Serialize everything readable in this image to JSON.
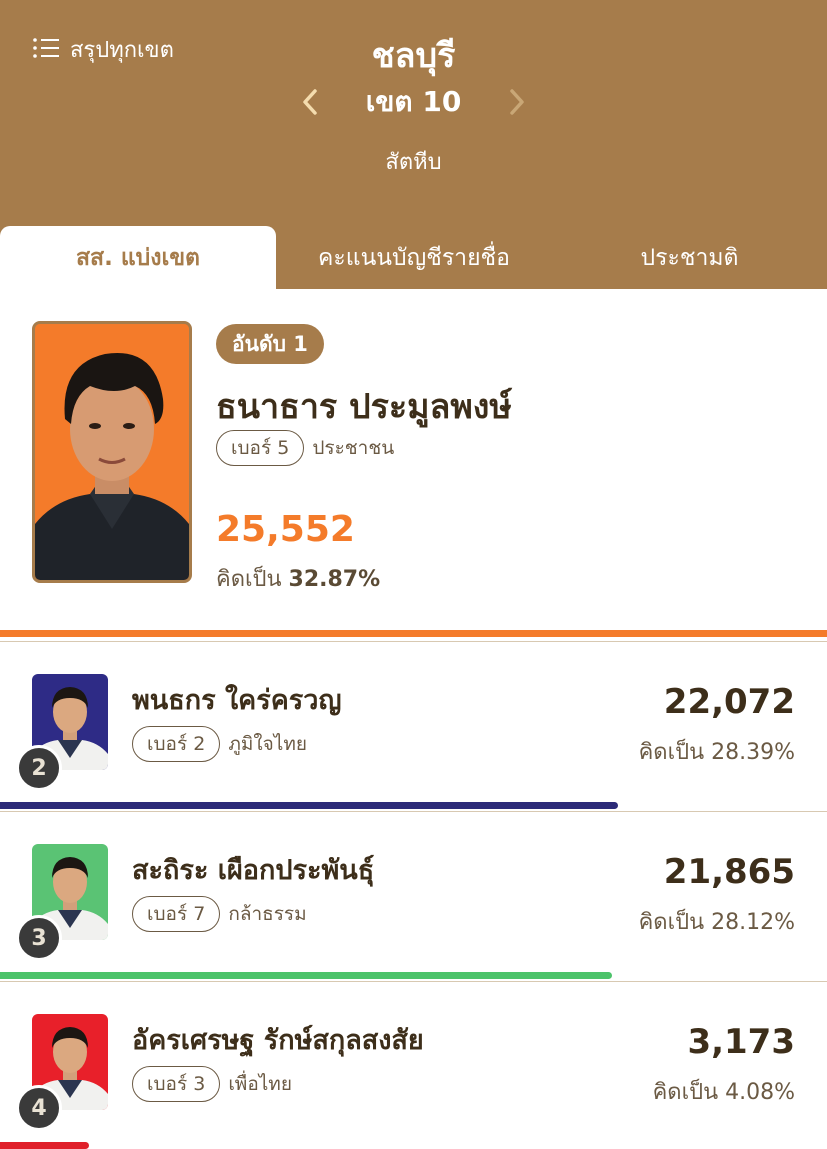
{
  "header": {
    "summary_label": "สรุปทุกเขต",
    "province": "ชลบุรี",
    "district": "เขต 10",
    "area": "สัตหีบ",
    "background": "#a67c4b"
  },
  "tabs": [
    {
      "label": "สส. แบ่งเขต",
      "active": true
    },
    {
      "label": "คะแนนบัญชีรายชื่อ",
      "active": false
    },
    {
      "label": "ประชามติ",
      "active": false
    }
  ],
  "winner": {
    "rank_label": "อันดับ 1",
    "name": "ธนาธาร ประมูลพงษ์",
    "number_label": "เบอร์ 5",
    "party": "ประชาชน",
    "votes": "25,552",
    "pct_prefix": "คิดเป็น",
    "pct": "32.87%",
    "color": "#f47b2a",
    "bar_fraction": 1.0
  },
  "candidates": [
    {
      "rank": "2",
      "name": "พนธกร ใคร่ครวญ",
      "number_label": "เบอร์ 2",
      "party": "ภูมิใจไทย",
      "votes": "22,072",
      "pct_text": "คิดเป็น 28.39%",
      "color": "#2c2a78",
      "photo_bg": "#2e2b86",
      "bar_fraction": 0.864
    },
    {
      "rank": "3",
      "name": "สะถิระ เผือกประพันธุ์",
      "number_label": "เบอร์ 7",
      "party": "กล้าธรรม",
      "votes": "21,865",
      "pct_text": "คิดเป็น 28.12%",
      "color": "#4cc36a",
      "photo_bg": "#5ac374",
      "bar_fraction": 0.856
    },
    {
      "rank": "4",
      "name": "อัครเศรษฐ รักษ์สกุลสงสัย",
      "number_label": "เบอร์ 3",
      "party": "เพื่อไทย",
      "votes": "3,173",
      "pct_text": "คิดเป็น 4.08%",
      "color": "#e0202a",
      "photo_bg": "#e8202a",
      "bar_fraction": 0.124
    }
  ]
}
